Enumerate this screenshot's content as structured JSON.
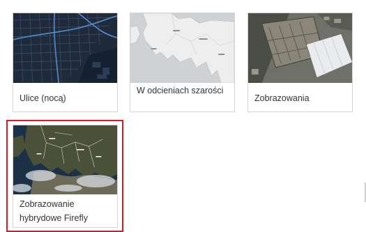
{
  "basemaps": [
    {
      "label": "Ulice (nocą)",
      "thumbnail": "night-streets-map-thumbnail",
      "selected": false
    },
    {
      "label": "W odcieniach szarości",
      "thumbnail": "light-gray-canvas-map-thumbnail",
      "selected": false
    },
    {
      "label": "Zobrazowania",
      "thumbnail": "satellite-imagery-thumbnail",
      "selected": false
    },
    {
      "label": "Zobrazowanie hybrydowe Firefly",
      "thumbnail": "firefly-hybrid-imagery-thumbnail",
      "selected": true
    }
  ],
  "colors": {
    "selection_border": "#e3151d",
    "card_border": "#d4d4d4",
    "label_text": "#333333"
  }
}
